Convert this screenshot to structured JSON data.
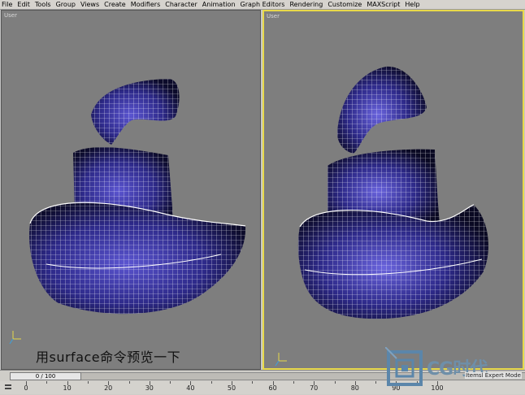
{
  "menubar": {
    "items": [
      "File",
      "Edit",
      "Tools",
      "Group",
      "Views",
      "Create",
      "Modifiers",
      "Character",
      "Animation",
      "Graph Editors",
      "Rendering",
      "Customize",
      "MAXScript",
      "Help"
    ]
  },
  "viewports": {
    "left_label": "User",
    "right_label": "User",
    "left_active": false,
    "right_active": true,
    "active_border_color": "#e8d94a",
    "wireframe_color": "#ffffff",
    "surface_color": "#2e2a8a"
  },
  "caption": "用surface命令预览一下",
  "timeline": {
    "frame_display": "0 / 100",
    "ruler_labels": [
      "0",
      "10",
      "20",
      "30",
      "40",
      "50",
      "60",
      "70",
      "80",
      "90",
      "100"
    ]
  },
  "logo": {
    "text": "CG时代",
    "sub": "Itemsl Expert Mode"
  }
}
